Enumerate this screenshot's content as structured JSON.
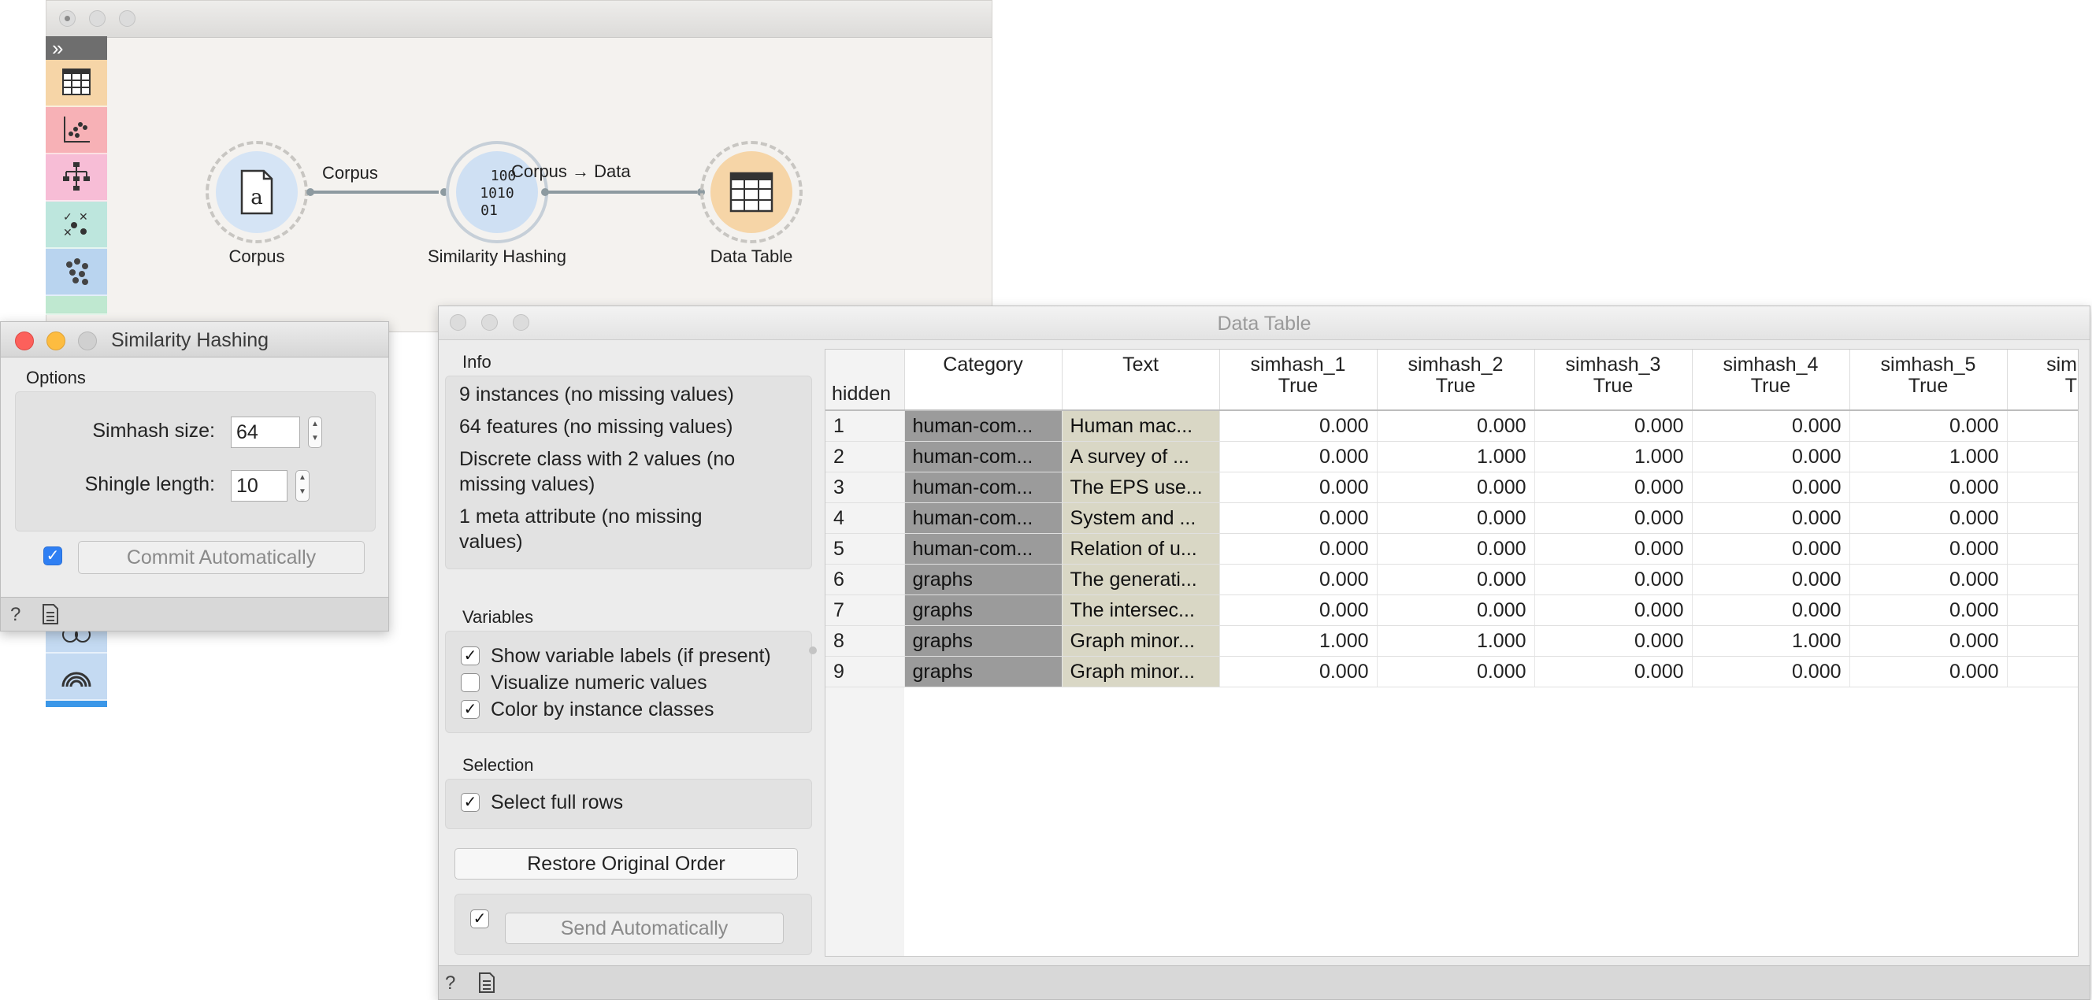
{
  "canvas": {
    "toolbox_toggle": "»",
    "nodes": {
      "corpus": "Corpus",
      "similarity_hashing": "Similarity Hashing",
      "data_table": "Data Table"
    },
    "links": {
      "corpus_to_hashing": "Corpus",
      "hashing_to_table": "Corpus → Data"
    },
    "hashing_icon_text": [
      "100",
      "1010",
      "01"
    ],
    "corpus_icon_text": "a",
    "toolbox_icons": [
      "data-table-icon",
      "scatter-plot-icon",
      "tree-icon",
      "test-learners-icon",
      "clusters-icon",
      "partial-icon",
      "globe-icon",
      "network-icon",
      "venn-icon",
      "rainbow-icon"
    ],
    "toolbox_colors": [
      "#f6d5a7",
      "#f7b1b6",
      "#f7bdd6",
      "#bde6dd",
      "#b9d4ef",
      "#bfe8d0",
      "#bfe8d0",
      "#bff2b0",
      "#c4daf2",
      "#c4daf2"
    ]
  },
  "similarity_hashing": {
    "title": "Similarity Hashing",
    "options_label": "Options",
    "simhash_size_label": "Simhash size:",
    "simhash_size_value": "64",
    "shingle_length_label": "Shingle length:",
    "shingle_length_value": "10",
    "commit_label": "Commit Automatically",
    "commit_checked": true
  },
  "data_table": {
    "title": "Data Table",
    "info_label": "Info",
    "info_lines": [
      "9 instances (no missing values)",
      "64 features (no missing values)",
      "Discrete class with 2 values (no",
      "missing values)",
      "1 meta attribute (no missing",
      "values)"
    ],
    "variables_label": "Variables",
    "show_labels": "Show variable labels (if present)",
    "visualize_numeric": "Visualize numeric values",
    "color_by_class": "Color by instance classes",
    "selection_label": "Selection",
    "select_full_rows": "Select full rows",
    "restore_button": "Restore Original Order",
    "send_automatically": "Send Automatically",
    "hidden_label": "hidden",
    "columns": [
      {
        "name": "Category",
        "sub": ""
      },
      {
        "name": "Text",
        "sub": ""
      },
      {
        "name": "simhash_1",
        "sub": "True"
      },
      {
        "name": "simhash_2",
        "sub": "True"
      },
      {
        "name": "simhash_3",
        "sub": "True"
      },
      {
        "name": "simhash_4",
        "sub": "True"
      },
      {
        "name": "simhash_5",
        "sub": "True"
      },
      {
        "name": "sim",
        "sub": "T"
      }
    ],
    "rows": [
      {
        "idx": "1",
        "category": "human-com...",
        "text": "Human mac...",
        "values": [
          "0.000",
          "0.000",
          "0.000",
          "0.000",
          "0.000"
        ]
      },
      {
        "idx": "2",
        "category": "human-com...",
        "text": "A survey of ...",
        "values": [
          "0.000",
          "1.000",
          "1.000",
          "0.000",
          "1.000"
        ]
      },
      {
        "idx": "3",
        "category": "human-com...",
        "text": "The EPS use...",
        "values": [
          "0.000",
          "0.000",
          "0.000",
          "0.000",
          "0.000"
        ]
      },
      {
        "idx": "4",
        "category": "human-com...",
        "text": "System and ...",
        "values": [
          "0.000",
          "0.000",
          "0.000",
          "0.000",
          "0.000"
        ]
      },
      {
        "idx": "5",
        "category": "human-com...",
        "text": "Relation of u...",
        "values": [
          "0.000",
          "0.000",
          "0.000",
          "0.000",
          "0.000"
        ]
      },
      {
        "idx": "6",
        "category": "graphs",
        "text": "The generati...",
        "values": [
          "0.000",
          "0.000",
          "0.000",
          "0.000",
          "0.000"
        ]
      },
      {
        "idx": "7",
        "category": "graphs",
        "text": "The intersec...",
        "values": [
          "0.000",
          "0.000",
          "0.000",
          "0.000",
          "0.000"
        ]
      },
      {
        "idx": "8",
        "category": "graphs",
        "text": "Graph minor...",
        "values": [
          "1.000",
          "1.000",
          "0.000",
          "1.000",
          "0.000"
        ]
      },
      {
        "idx": "9",
        "category": "graphs",
        "text": "Graph minor...",
        "values": [
          "0.000",
          "0.000",
          "0.000",
          "0.000",
          "0.000"
        ]
      }
    ]
  }
}
